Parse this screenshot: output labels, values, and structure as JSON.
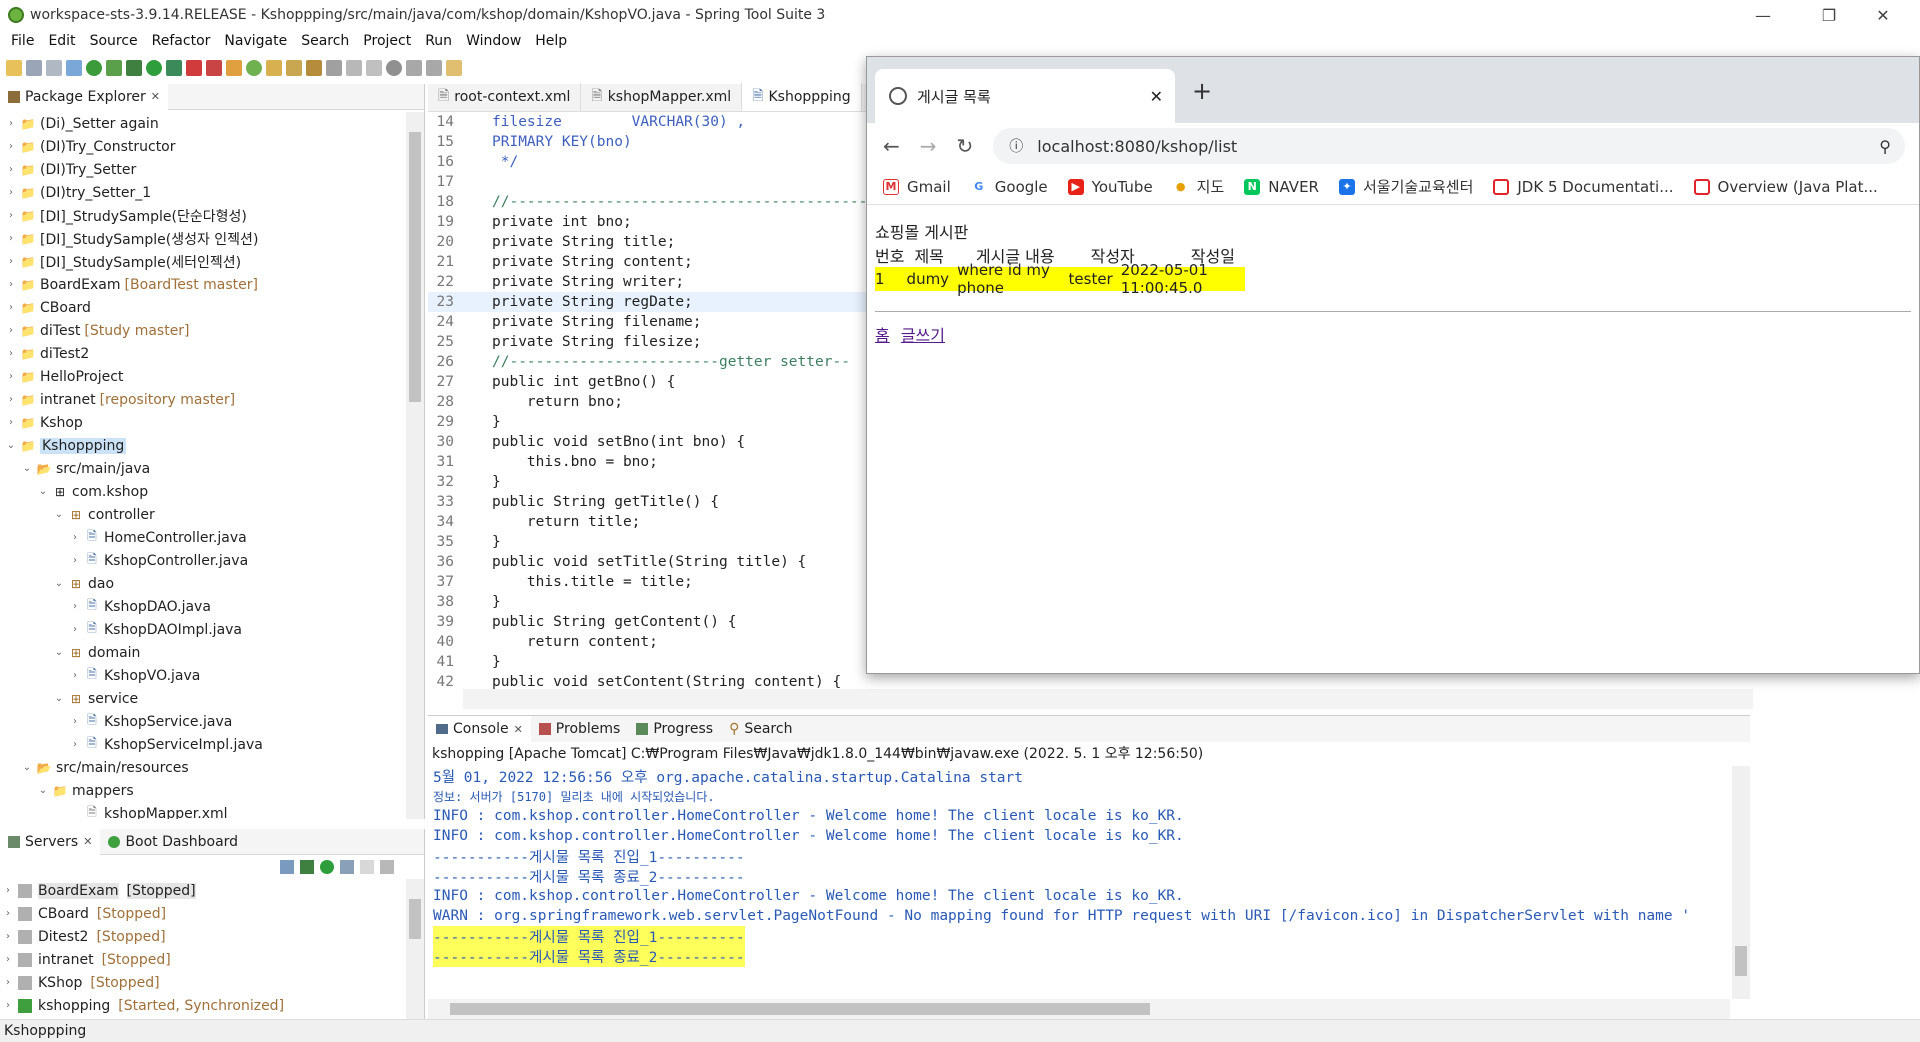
{
  "window": {
    "title": "workspace-sts-3.9.14.RELEASE - Kshoppping/src/main/java/com/kshop/domain/KshopVO.java - Spring Tool Suite 3",
    "min": "—",
    "restore": "❐",
    "close": "✕"
  },
  "menu": [
    "File",
    "Edit",
    "Source",
    "Refactor",
    "Navigate",
    "Search",
    "Project",
    "Run",
    "Window",
    "Help"
  ],
  "package_explorer": {
    "title": "Package Explorer",
    "items": [
      {
        "label": "(Di)_Setter again",
        "git": ""
      },
      {
        "label": "(DI)Try_Constructor",
        "git": ""
      },
      {
        "label": "(DI)Try_Setter",
        "git": ""
      },
      {
        "label": "(DI)try_Setter_1",
        "git": ""
      },
      {
        "label": "[DI]_StrudySample(단순다형성)",
        "git": ""
      },
      {
        "label": "[DI]_StudySample(생성자 인젝션)",
        "git": ""
      },
      {
        "label": "[DI]_StudySample(세터인젝션)",
        "git": ""
      },
      {
        "label": "BoardExam",
        "git": "[BoardTest master]"
      },
      {
        "label": "CBoard",
        "git": ""
      },
      {
        "label": "diTest",
        "git": "[Study master]"
      },
      {
        "label": "diTest2",
        "git": ""
      },
      {
        "label": "HelloProject",
        "git": ""
      },
      {
        "label": "intranet",
        "git": "[repository master]"
      },
      {
        "label": "Kshop",
        "git": ""
      },
      {
        "label": "Kshoppping",
        "git": ""
      },
      {
        "label": "src/main/java",
        "git": ""
      },
      {
        "label": "com.kshop",
        "git": ""
      },
      {
        "label": "controller",
        "git": ""
      },
      {
        "label": "HomeController.java",
        "git": ""
      },
      {
        "label": "KshopController.java",
        "git": ""
      },
      {
        "label": "dao",
        "git": ""
      },
      {
        "label": "KshopDAO.java",
        "git": ""
      },
      {
        "label": "KshopDAOImpl.java",
        "git": ""
      },
      {
        "label": "domain",
        "git": ""
      },
      {
        "label": "KshopVO.java",
        "git": ""
      },
      {
        "label": "service",
        "git": ""
      },
      {
        "label": "KshopService.java",
        "git": ""
      },
      {
        "label": "KshopServiceImpl.java",
        "git": ""
      },
      {
        "label": "src/main/resources",
        "git": ""
      },
      {
        "label": "mappers",
        "git": ""
      },
      {
        "label": "kshopMapper.xml",
        "git": ""
      }
    ]
  },
  "servers": {
    "tab1": "Servers",
    "tab2": "Boot Dashboard",
    "items": [
      {
        "label": "BoardExam",
        "status": "[Stopped]"
      },
      {
        "label": "CBoard",
        "status": "[Stopped]"
      },
      {
        "label": "Ditest2",
        "status": "[Stopped]"
      },
      {
        "label": "intranet",
        "status": "[Stopped]"
      },
      {
        "label": "KShop",
        "status": "[Stopped]"
      },
      {
        "label": "kshopping",
        "status": "[Started, Synchronized]"
      }
    ]
  },
  "editor": {
    "tabs": [
      "root-context.xml",
      "kshopMapper.xml",
      "Kshoppping"
    ],
    "lines": [
      {
        "n": "14",
        "t": "filesize        VARCHAR(30) ,"
      },
      {
        "n": "15",
        "t": "PRIMARY KEY(bno)"
      },
      {
        "n": "16",
        "t": " */"
      },
      {
        "n": "17",
        "t": ""
      },
      {
        "n": "18",
        "t": "//------------------------------------------"
      },
      {
        "n": "19",
        "t": "private int bno;"
      },
      {
        "n": "20",
        "t": "private String title;"
      },
      {
        "n": "21",
        "t": "private String content;"
      },
      {
        "n": "22",
        "t": "private String writer;"
      },
      {
        "n": "23",
        "t": "private String regDate;"
      },
      {
        "n": "24",
        "t": "private String filename;"
      },
      {
        "n": "25",
        "t": "private String filesize;"
      },
      {
        "n": "26",
        "t": "//------------------------getter setter--"
      },
      {
        "n": "27",
        "t": "public int getBno() {"
      },
      {
        "n": "28",
        "t": "    return bno;"
      },
      {
        "n": "29",
        "t": "}"
      },
      {
        "n": "30",
        "t": "public void setBno(int bno) {"
      },
      {
        "n": "31",
        "t": "    this.bno = bno;"
      },
      {
        "n": "32",
        "t": "}"
      },
      {
        "n": "33",
        "t": "public String getTitle() {"
      },
      {
        "n": "34",
        "t": "    return title;"
      },
      {
        "n": "35",
        "t": "}"
      },
      {
        "n": "36",
        "t": "public void setTitle(String title) {"
      },
      {
        "n": "37",
        "t": "    this.title = title;"
      },
      {
        "n": "38",
        "t": "}"
      },
      {
        "n": "39",
        "t": "public String getContent() {"
      },
      {
        "n": "40",
        "t": "    return content;"
      },
      {
        "n": "41",
        "t": "}"
      },
      {
        "n": "42",
        "t": "public void setContent(String content) {"
      }
    ]
  },
  "console": {
    "tabs": [
      "Console",
      "Problems",
      "Progress",
      "Search"
    ],
    "header": "kshopping [Apache Tomcat] C:₩Program Files₩Java₩jdk1.8.0_144₩bin₩javaw.exe  (2022. 5. 1 오후 12:56:50)",
    "lines": [
      "5월 01, 2022 12:56:56 오후 org.apache.catalina.startup.Catalina start",
      "정보: 서버가 [5170] 밀리초 내에 시작되었습니다.",
      "INFO : com.kshop.controller.HomeController - Welcome home! The client locale is ko_KR.",
      "INFO : com.kshop.controller.HomeController - Welcome home! The client locale is ko_KR.",
      "-----------게시물 목록 진입_1----------",
      "-----------게시물 목록 종료_2----------",
      "INFO : com.kshop.controller.HomeController - Welcome home! The client locale is ko_KR.",
      "WARN : org.springframework.web.servlet.PageNotFound - No mapping found for HTTP request with URI [/favicon.ico] in DispatcherServlet with name '",
      "-----------게시물 목록 진입_1----------",
      "-----------게시물 목록 종료_2----------"
    ]
  },
  "status_bar": "Kshoppping",
  "browser": {
    "tab_title": "게시글 목록",
    "url": "localhost:8080/kshop/list",
    "bookmarks": [
      "Gmail",
      "Google",
      "YouTube",
      "지도",
      "NAVER",
      "서울기술교육센터",
      "JDK 5 Documentati...",
      "Overview (Java Plat..."
    ],
    "page": {
      "heading": "쇼핑몰 게시판",
      "columns": [
        "번호",
        "제목",
        "게시글 내용",
        "작성자",
        "작성일"
      ],
      "row": {
        "no": "1",
        "title": "dumy",
        "content": "where id my phone",
        "writer": "tester",
        "date": "2022-05-01 11:00:45.0"
      },
      "links": [
        "홈",
        "글쓰기"
      ]
    }
  },
  "colors": {
    "highlight": "#ffff5c",
    "keyword": "#7f0055",
    "field": "#0000c0",
    "console_text": "#2a59b5"
  }
}
